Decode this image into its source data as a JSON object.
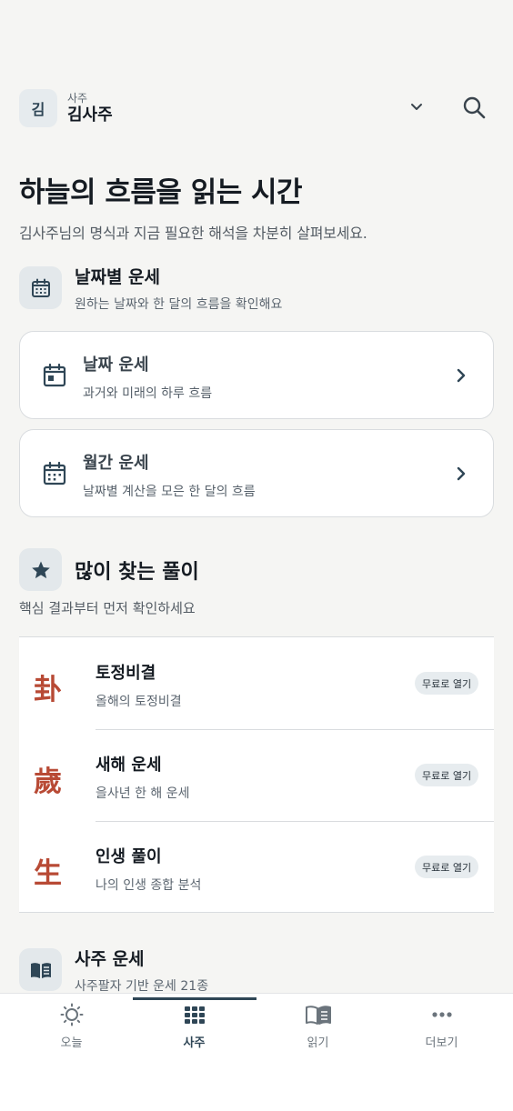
{
  "header": {
    "avatar_initial": "김",
    "profile_sub": "사주",
    "profile_name": "김사주"
  },
  "hero": {
    "title": "하늘의 흐름을 읽는 시간",
    "description": "김사주님의 명식과 지금 필요한 해석을 차분히 살펴보세요."
  },
  "date_section": {
    "title": "날짜별 운세",
    "subtitle": "원하는 날짜와 한 달의 흐름을 확인해요",
    "cards": [
      {
        "title": "날짜 운세",
        "subtitle": "과거와 미래의 하루 흐름",
        "icon": "calendar-day-icon"
      },
      {
        "title": "월간 운세",
        "subtitle": "날짜별 계산을 모은 한 달의 흐름",
        "icon": "calendar-month-icon"
      }
    ]
  },
  "popular": {
    "title": "많이 찾는 풀이",
    "subtitle": "핵심 결과부터 먼저 확인하세요",
    "items": [
      {
        "hanja": "卦",
        "title": "토정비결",
        "subtitle": "올해의 토정비결",
        "badge": "무료로 열기"
      },
      {
        "hanja": "歲",
        "title": "새해 운세",
        "subtitle": "을사년 한 해 운세",
        "badge": "무료로 열기"
      },
      {
        "hanja": "生",
        "title": "인생 풀이",
        "subtitle": "나의 인생 종합 분석",
        "badge": "무료로 열기"
      }
    ]
  },
  "saju_section": {
    "title": "사주 운세",
    "subtitle": "사주팔자 기반 운세 21종"
  },
  "tabs": [
    {
      "label": "오늘",
      "icon": "sun-icon",
      "active": false
    },
    {
      "label": "사주",
      "icon": "grid-icon",
      "active": true
    },
    {
      "label": "읽기",
      "icon": "book-icon",
      "active": false
    },
    {
      "label": "더보기",
      "icon": "more-icon",
      "active": false
    }
  ],
  "colors": {
    "accent": "#2f4656",
    "hanja": "#b84a35",
    "background": "#f5f5f3"
  }
}
